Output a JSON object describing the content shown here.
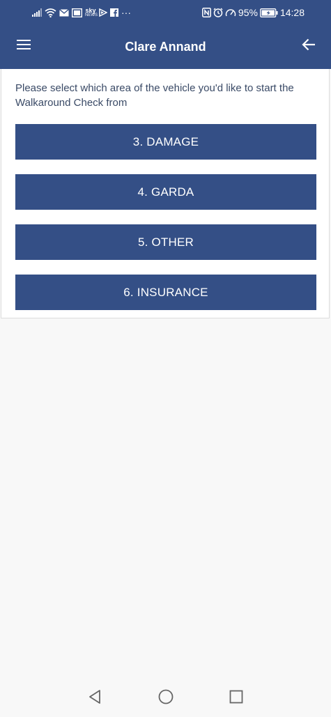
{
  "status_bar": {
    "left_icons": [
      "signal-icon",
      "wifi-icon",
      "mail-icon",
      "message-icon",
      "sky-news-icon",
      "play-icon",
      "facebook-icon",
      "more-icon"
    ],
    "sky_news_top": "sky",
    "sky_news_bottom": "NEWS",
    "more": "···",
    "right_icons": [
      "nfc-icon",
      "alarm-icon",
      "speed-icon",
      "battery-icon"
    ],
    "battery_percent": "95%",
    "time": "14:28"
  },
  "app_bar": {
    "title": "Clare Annand",
    "menu_icon": "hamburger-menu-icon",
    "back_icon": "arrow-left-icon",
    "color": "#344f86"
  },
  "content": {
    "instructions": "Please select which area of the vehicle you'd like to start the Walkaround Check from",
    "buttons": [
      {
        "label": "3. DAMAGE"
      },
      {
        "label": "4. GARDA"
      },
      {
        "label": "5. OTHER"
      },
      {
        "label": "6. INSURANCE"
      }
    ]
  },
  "nav_bar": {
    "icons": [
      "back-triangle-icon",
      "home-circle-icon",
      "recents-square-icon"
    ]
  },
  "colors": {
    "primary": "#344f86",
    "background": "#f8f8f8",
    "card": "#ffffff",
    "text": "#3a4a66"
  }
}
